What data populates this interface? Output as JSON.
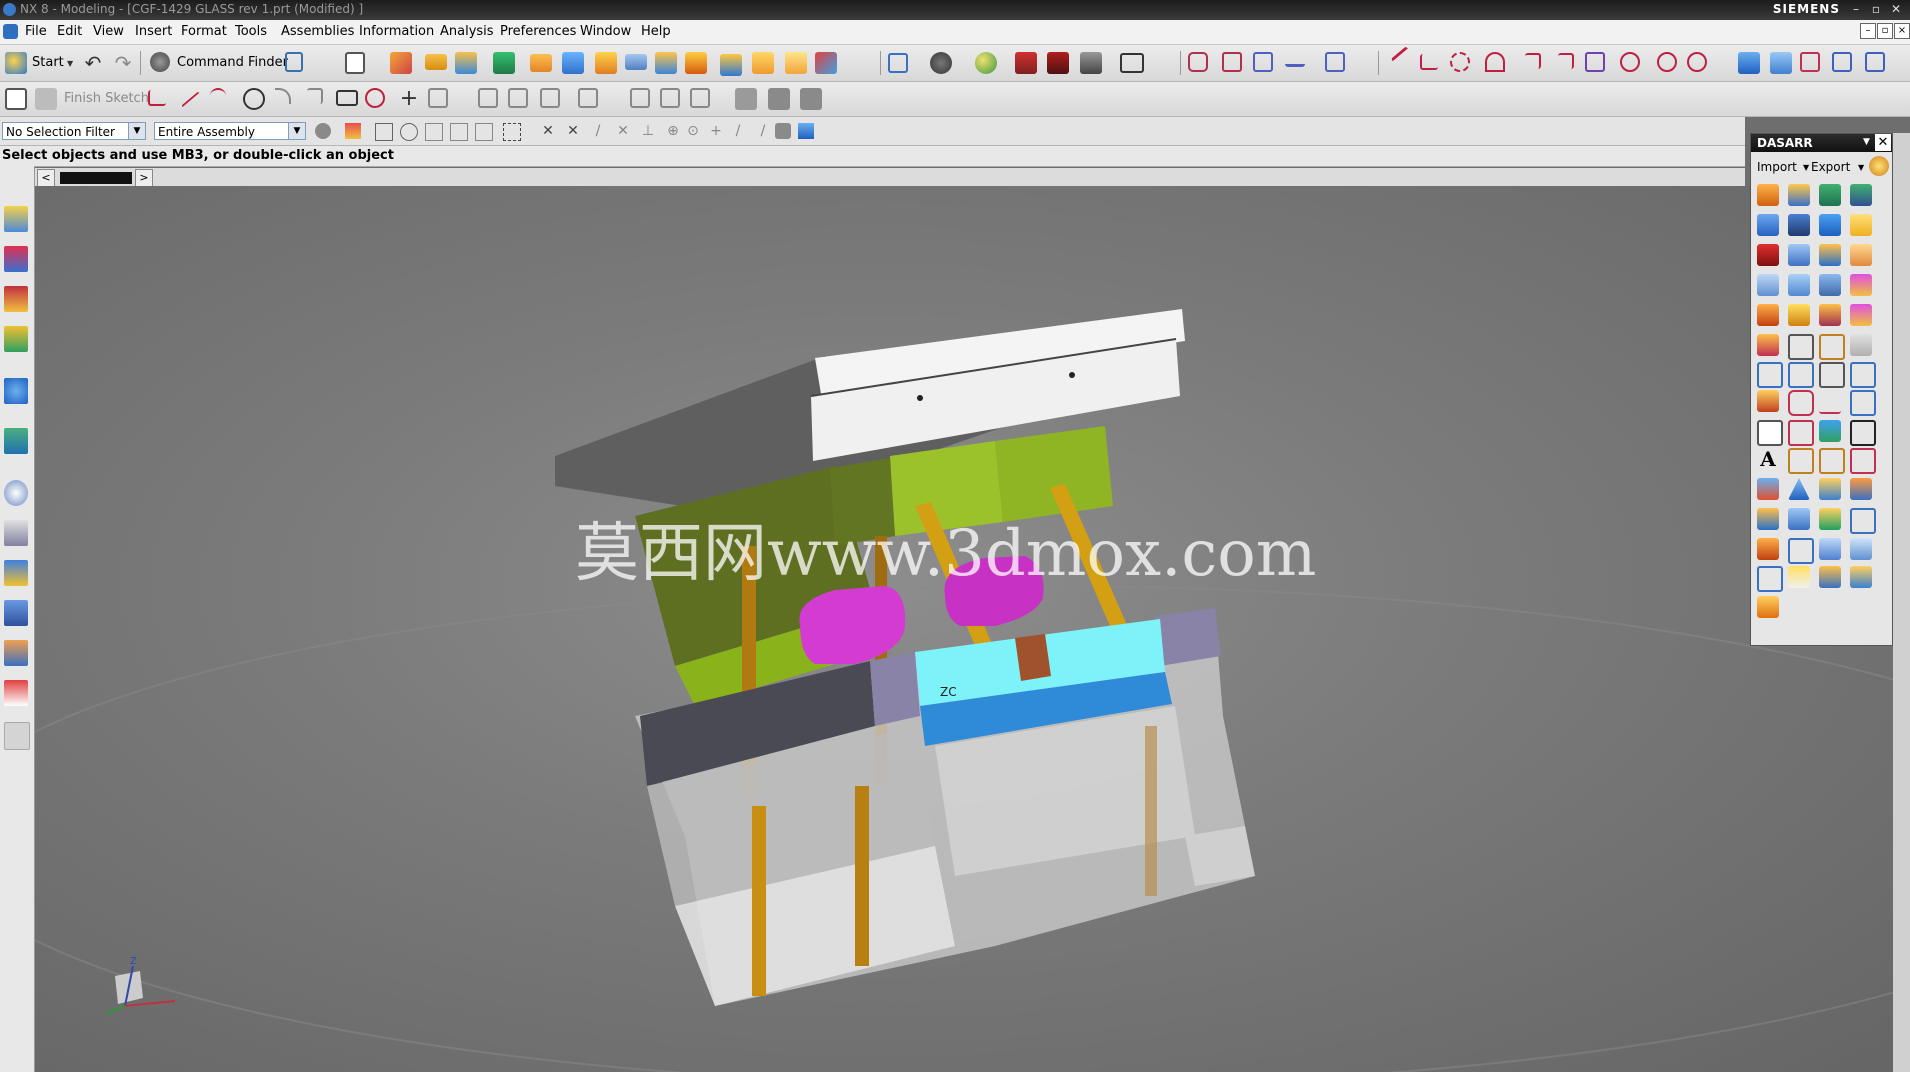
{
  "window": {
    "title": "NX 8 - Modeling - [CGF-1429 GLASS rev 1.prt (Modified) ]",
    "brand": "SIEMENS",
    "controls": [
      "–",
      "▫",
      "✕"
    ]
  },
  "menu": {
    "items": [
      "File",
      "Edit",
      "View",
      "Insert",
      "Format",
      "Tools",
      "Assemblies",
      "Information",
      "Analysis",
      "Preferences",
      "Window",
      "Help"
    ]
  },
  "toolbar": {
    "start_label": "Start",
    "command_finder_label": "Command Finder",
    "finish_sketch_label": "Finish Sketch"
  },
  "selection": {
    "filter_value": "No Selection Filter",
    "scope_value": "Entire Assembly"
  },
  "status": {
    "prompt": "Select objects and use MB3, or double-click an object"
  },
  "viewport": {
    "watermark": "莫西网www.3dmox.com",
    "wcs_label": "ZC",
    "triad_z": "Z"
  },
  "panel": {
    "title": "DASARR",
    "import_label": "Import",
    "export_label": "Export"
  },
  "colors": {
    "plate_white": "#f4f4f4",
    "plate_green": "#9cc22b",
    "insert_cyan": "#7df2f8",
    "insert_blue": "#2f8ad8",
    "part_magenta": "#d33bd1",
    "pin_gold": "#d3a014",
    "plate_dark": "#4a4a55",
    "plate_purple": "#8a83a8"
  }
}
